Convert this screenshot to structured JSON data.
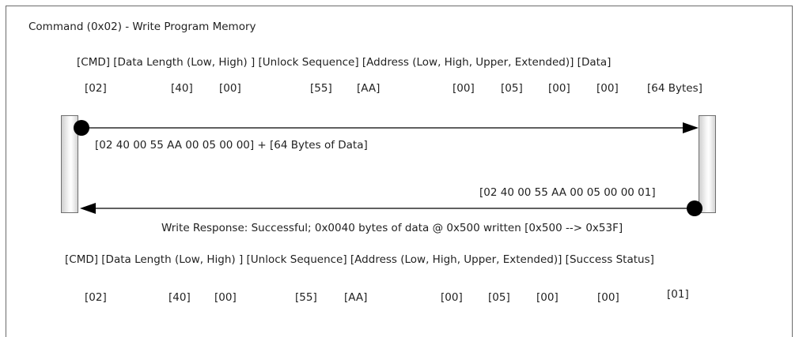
{
  "title": "Command (0x02) - Write Program Memory",
  "request": {
    "header": "[CMD] [Data Length (Low, High) ] [Unlock Sequence]  [Address (Low, High, Upper, Extended)] [Data]",
    "values": [
      "[02]",
      "[40]",
      "[00]",
      "[55]",
      "[AA]",
      "[00]",
      "[05]",
      "[00]",
      "[00]",
      "[64 Bytes]"
    ],
    "arrow_label": "[02 40 00 55 AA 00 05 00 00] + [64 Bytes of Data]"
  },
  "response": {
    "arrow_label": "[02 40 00 55 AA 00 05 00 00 01]",
    "description": "Write Response: Successful; 0x0040 bytes of data @ 0x500 written [0x500 --> 0x53F]",
    "header": "[CMD] [Data Length (Low, High) ] [Unlock Sequence] [Address (Low, High, Upper, Extended)] [Success Status]",
    "values": [
      "[02]",
      "[40]",
      "[00]",
      "[55]",
      "[AA]",
      "[00]",
      "[05]",
      "[00]",
      "[00]",
      "[01]"
    ]
  },
  "colors": {
    "line": "#000000",
    "bar_border": "#6f6f6f",
    "frame": "#6b6b6b"
  }
}
